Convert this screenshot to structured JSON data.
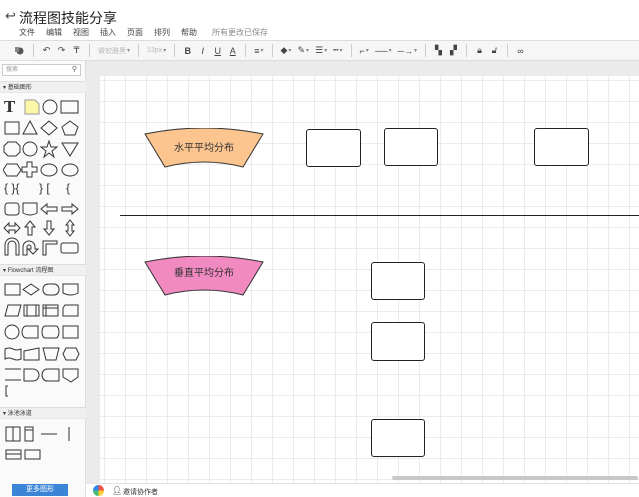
{
  "header": {
    "title": "流程图技能分享",
    "menu": [
      "文件",
      "编辑",
      "视图",
      "插入",
      "页面",
      "排列",
      "帮助"
    ],
    "save_status": "所有更改已保存"
  },
  "toolbar": {
    "font_name": "微软雅黑",
    "font_size": "13px",
    "bold": "B",
    "italic": "I",
    "underline": "U",
    "font_color": "A"
  },
  "sidebar": {
    "search_placeholder": "搜索",
    "sections": [
      "基础图形",
      "Flowchart 流程图",
      "泳池泳道"
    ],
    "more_shapes": "更多图形"
  },
  "canvas": {
    "shape1_label": "水平平均分布",
    "shape1_color": "#fcc58f",
    "shape2_label": "垂直平均分布",
    "shape2_color": "#f28ac2"
  },
  "footer": {
    "invite": "邀请协作者"
  }
}
